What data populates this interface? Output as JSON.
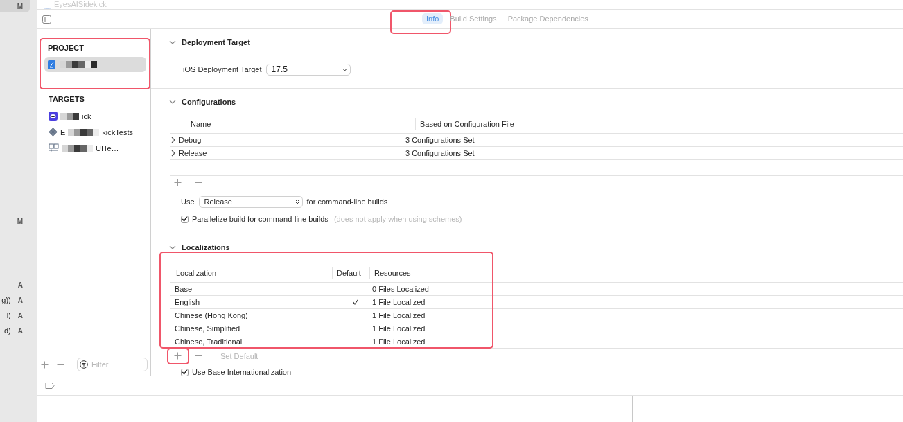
{
  "top_bar": {
    "title": "EyesAISidekick"
  },
  "gutter": [
    {
      "letter": "M",
      "selected": true
    },
    {
      "letter": "M",
      "selected": false
    },
    {
      "letter": "A",
      "selected": false
    },
    {
      "text": "g))",
      "letter": "A",
      "selected": false
    },
    {
      "text": "l)",
      "letter": "A",
      "selected": false
    },
    {
      "text": "d)",
      "letter": "A",
      "selected": false
    }
  ],
  "tabs": [
    {
      "label": "Info",
      "selected": true,
      "highlighted": true
    },
    {
      "label": "Build Settings",
      "selected": false,
      "highlighted": false
    },
    {
      "label": "Package Dependencies",
      "selected": false,
      "highlighted": false
    }
  ],
  "sidebar": {
    "project_header": "PROJECT",
    "highlighted": true,
    "project": {
      "selected": true
    },
    "targets_header": "TARGETS",
    "targets": [
      {
        "kind": "app",
        "text": "ick"
      },
      {
        "kind": "tests",
        "prefix": "E",
        "text": "kickTests"
      },
      {
        "kind": "uitests",
        "text": "UITe…"
      }
    ],
    "filter": {
      "placeholder": "Filter"
    }
  },
  "deployment": {
    "title": "Deployment Target",
    "expanded": true,
    "label": "iOS Deployment Target",
    "value": "17.5"
  },
  "configurations": {
    "title": "Configurations",
    "expanded": true,
    "columns": [
      "Name",
      "Based on Configuration File"
    ],
    "rows": [
      {
        "name": "Debug",
        "file": "3 Configurations Set",
        "expanded": false
      },
      {
        "name": "Release",
        "file": "3 Configurations Set",
        "expanded": false
      }
    ],
    "use_label": "Use",
    "build_config": "Release",
    "suffix": "for command-line builds",
    "parallelize": {
      "label": "Parallelize build for command-line builds",
      "note": "(does not apply when using schemes)",
      "checked": true
    }
  },
  "localizations": {
    "title": "Localizations",
    "expanded": true,
    "highlighted": true,
    "columns": [
      "Localization",
      "Default",
      "Resources"
    ],
    "rows": [
      {
        "name": "Base",
        "default": false,
        "resources": "0 Files Localized"
      },
      {
        "name": "English",
        "default": true,
        "resources": "1 File Localized"
      },
      {
        "name": "Chinese (Hong Kong)",
        "default": false,
        "resources": "1 File Localized"
      },
      {
        "name": "Chinese, Simplified",
        "default": false,
        "resources": "1 File Localized"
      },
      {
        "name": "Chinese, Traditional",
        "default": false,
        "resources": "1 File Localized"
      }
    ],
    "add_highlighted": true,
    "set_default": "Set Default",
    "base_intl": {
      "label": "Use Base Internationalization",
      "checked": true
    }
  }
}
